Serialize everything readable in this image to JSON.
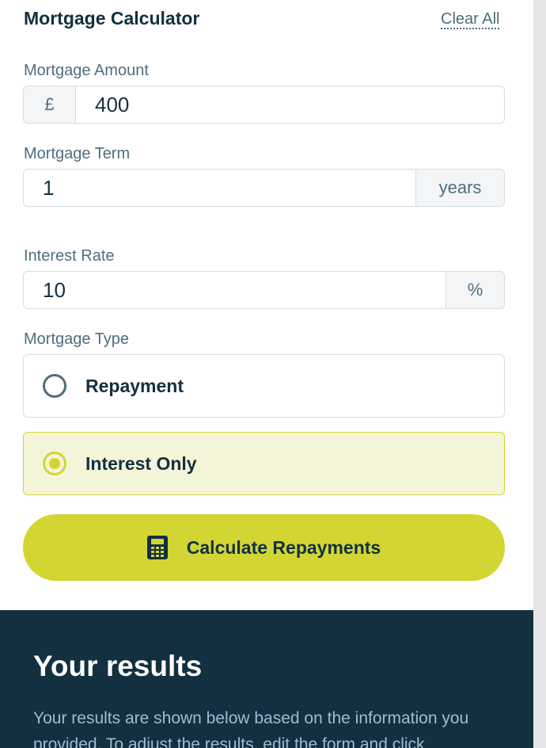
{
  "header": {
    "title": "Mortgage Calculator",
    "clear_label": "Clear All"
  },
  "amount": {
    "label": "Mortgage Amount",
    "prefix": "£",
    "value": "400"
  },
  "term": {
    "label": "Mortgage Term",
    "value": "1",
    "suffix": "years"
  },
  "rate": {
    "label": "Interest Rate",
    "value": "10",
    "suffix": "%"
  },
  "type": {
    "label": "Mortgage Type",
    "options": [
      {
        "label": "Repayment",
        "selected": false
      },
      {
        "label": "Interest Only",
        "selected": true
      }
    ]
  },
  "calculate": {
    "label": "Calculate Repayments",
    "icon": "calculator-icon"
  },
  "results": {
    "title": "Your results",
    "description": "Your results are shown below based on the information you provided. To adjust the results, edit the form and click"
  },
  "colors": {
    "accent": "#d3d533",
    "dark": "#133040",
    "muted": "#4e6e7e"
  }
}
